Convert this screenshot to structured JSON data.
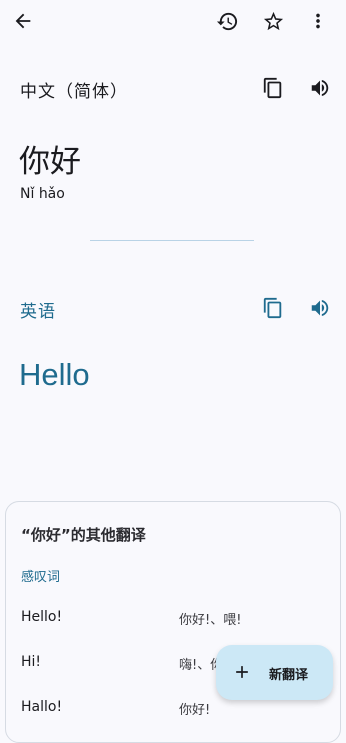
{
  "toolbar": {
    "back_icon": "arrow-back-icon",
    "history_icon": "history-icon",
    "star_icon": "star-outline-icon",
    "more_icon": "more-vert-icon"
  },
  "source": {
    "language": "中文（简体）",
    "text": "你好",
    "transliteration": "Nǐ hǎo",
    "copy_icon": "copy-icon",
    "speak_icon": "volume-icon"
  },
  "target": {
    "language": "英语",
    "text": "Hello",
    "copy_icon": "copy-icon",
    "speak_icon": "volume-icon"
  },
  "other_translations": {
    "title": "“你好”的其他翻译",
    "section": "感叹词",
    "rows": [
      {
        "en": "Hello!",
        "zh": "你好!、喂!"
      },
      {
        "en": "Hi!",
        "zh": "嗨!、你"
      },
      {
        "en": "Hallo!",
        "zh": "你好!"
      }
    ]
  },
  "fab": {
    "label": "新翻译",
    "icon": "plus-icon"
  },
  "colors": {
    "accent": "#1f6b8e",
    "background": "#f9f9fd",
    "fab_bg": "#cce8f6"
  }
}
